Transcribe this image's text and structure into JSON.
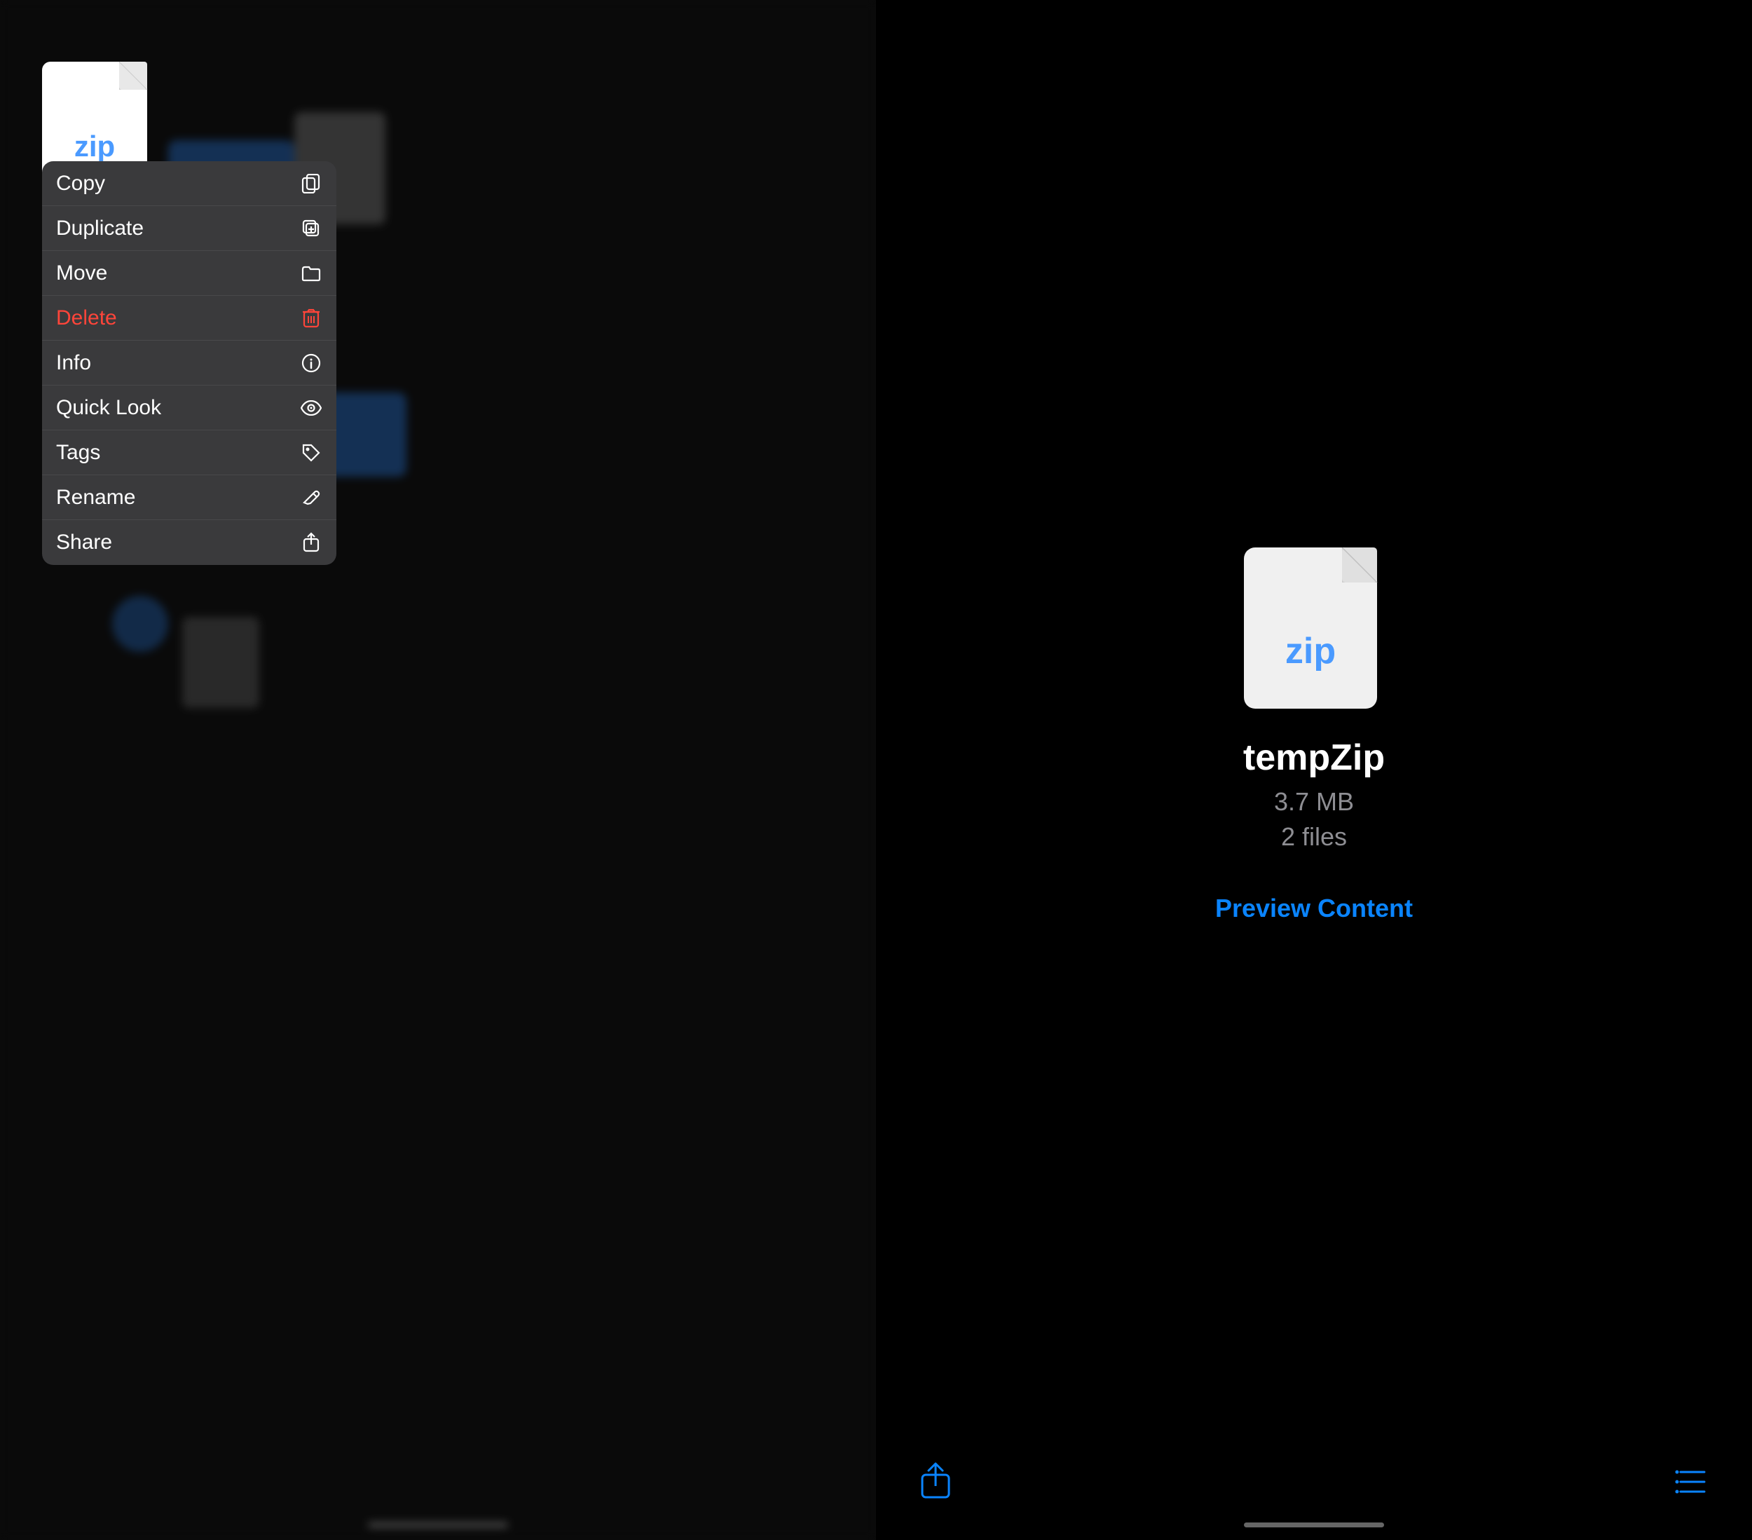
{
  "left_panel": {
    "background_color": "#1a1a1a",
    "zip_file": {
      "label": "zip"
    },
    "context_menu": {
      "items": [
        {
          "id": "copy",
          "label": "Copy",
          "icon": "copy-icon",
          "color": "normal"
        },
        {
          "id": "duplicate",
          "label": "Duplicate",
          "icon": "duplicate-icon",
          "color": "normal"
        },
        {
          "id": "move",
          "label": "Move",
          "icon": "folder-icon",
          "color": "normal"
        },
        {
          "id": "delete",
          "label": "Delete",
          "icon": "trash-icon",
          "color": "delete"
        },
        {
          "id": "info",
          "label": "Info",
          "icon": "info-icon",
          "color": "normal"
        },
        {
          "id": "quick-look",
          "label": "Quick Look",
          "icon": "eye-icon",
          "color": "normal"
        },
        {
          "id": "tags",
          "label": "Tags",
          "icon": "tag-icon",
          "color": "normal"
        },
        {
          "id": "rename",
          "label": "Rename",
          "icon": "pencil-icon",
          "color": "normal"
        },
        {
          "id": "share",
          "label": "Share",
          "icon": "share-icon",
          "color": "normal"
        }
      ]
    },
    "home_indicator": "white"
  },
  "right_panel": {
    "background_color": "#000000",
    "file": {
      "name": "tempZip",
      "size": "3.7 MB",
      "count": "2 files",
      "zip_label": "zip"
    },
    "preview_content_label": "Preview Content",
    "toolbar": {
      "share_icon": "share-icon",
      "list_icon": "list-icon"
    },
    "home_indicator": "white"
  }
}
